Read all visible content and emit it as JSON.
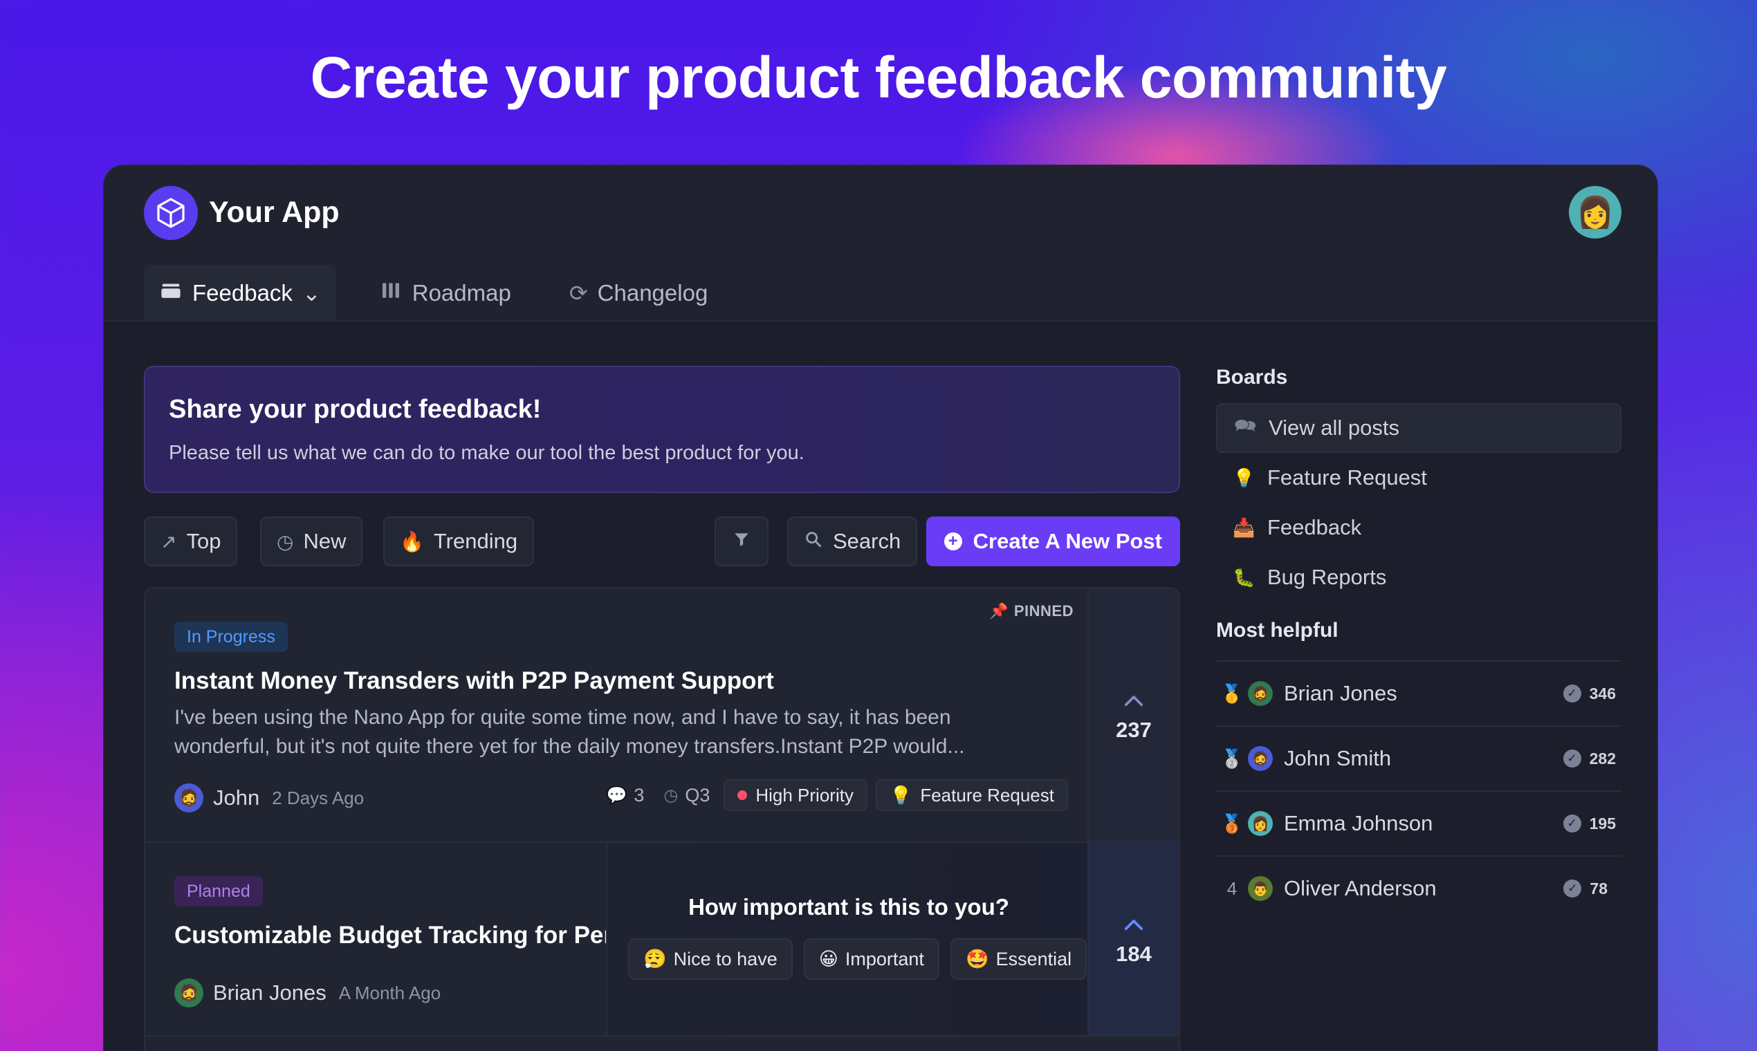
{
  "hero": {
    "title": "Create your product feedback community"
  },
  "app": {
    "name": "Your App",
    "avatar_icon": "user-avatar-icon"
  },
  "tabs": [
    {
      "label": "Feedback",
      "icon": "inbox-stack-icon",
      "active": true
    },
    {
      "label": "Roadmap",
      "icon": "map-icon",
      "active": false
    },
    {
      "label": "Changelog",
      "icon": "refresh-icon",
      "active": false
    }
  ],
  "banner": {
    "title": "Share your product feedback!",
    "text": "Please tell us what we can do to make our tool the best product for you."
  },
  "filters": {
    "top": "Top",
    "new": "New",
    "trending": "Trending",
    "search": "Search",
    "create": "Create A New Post"
  },
  "posts": [
    {
      "status": "In Progress",
      "pinned": "PINNED",
      "title": "Instant Money Transders with P2P Payment Support",
      "description": "I've been using the Nano App for quite some time now, and I have to say, it has been wonderful, but it's not quite there yet for the daily money transfers.Instant P2P would...",
      "author": "John",
      "time": "2 Days Ago",
      "comments": "3",
      "eta": "Q3",
      "priority": "High Priority",
      "board": "Feature Request",
      "votes": "237"
    },
    {
      "status": "Planned",
      "title": "Customizable Budget Tracking for Personal Finance",
      "author": "Brian Jones",
      "time": "A Month Ago",
      "votes": "184",
      "survey": {
        "question": "How important is this to you?",
        "options": [
          "Nice to have",
          "Important",
          "Essential"
        ]
      }
    }
  ],
  "sidebar": {
    "boards_title": "Boards",
    "boards": [
      {
        "label": "View all posts",
        "icon": "chat-bubbles-icon"
      },
      {
        "label": "Feature Request",
        "icon": "lightbulb-icon"
      },
      {
        "label": "Feedback",
        "icon": "inbox-tray-icon"
      },
      {
        "label": "Bug Reports",
        "icon": "bug-icon"
      }
    ],
    "helpful_title": "Most helpful",
    "helpful": [
      {
        "rank": "🥇",
        "name": "Brian Jones",
        "score": "346"
      },
      {
        "rank": "🥈",
        "name": "John Smith",
        "score": "282"
      },
      {
        "rank": "🥉",
        "name": "Emma Johnson",
        "score": "195"
      },
      {
        "rank": "4",
        "name": "Oliver Anderson",
        "score": "78"
      }
    ]
  },
  "colors": {
    "accent": "#6a3cf6",
    "in_progress": "#4f9cff",
    "planned": "#b27ff2",
    "priority_dot": "#ff4d6a"
  }
}
